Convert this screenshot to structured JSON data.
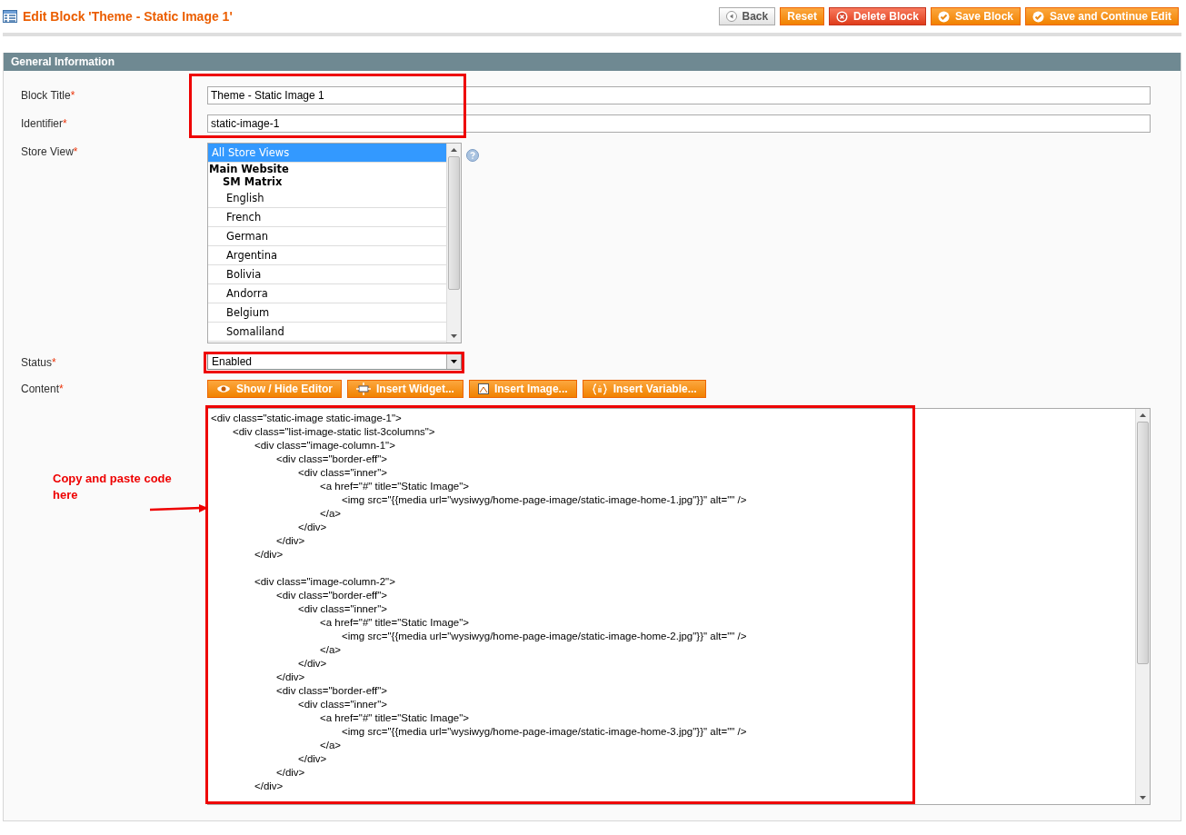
{
  "header": {
    "title": "Edit Block 'Theme - Static Image 1'",
    "buttons": [
      {
        "label": "Back",
        "kind": "back"
      },
      {
        "label": "Reset",
        "kind": "plain"
      },
      {
        "label": "Delete Block",
        "kind": "delete"
      },
      {
        "label": "Save Block",
        "kind": "save"
      },
      {
        "label": "Save and Continue Edit",
        "kind": "save"
      }
    ]
  },
  "section": {
    "title": "General Information"
  },
  "fields": {
    "block_title": {
      "label": "Block Title",
      "required": true,
      "value": "Theme - Static Image 1"
    },
    "identifier": {
      "label": "Identifier",
      "required": true,
      "value": "static-image-1"
    },
    "store_view": {
      "label": "Store View",
      "required": true,
      "options": [
        {
          "label": "All Store Views",
          "kind": "option",
          "selected": true
        },
        {
          "label": "Main Website",
          "kind": "group",
          "selected": false
        },
        {
          "label": "SM Matrix",
          "kind": "subgroup",
          "selected": false
        },
        {
          "label": "English",
          "kind": "option",
          "selected": false
        },
        {
          "label": "French",
          "kind": "option",
          "selected": false
        },
        {
          "label": "German",
          "kind": "option",
          "selected": false
        },
        {
          "label": "Argentina",
          "kind": "option",
          "selected": false
        },
        {
          "label": "Bolivia",
          "kind": "option",
          "selected": false
        },
        {
          "label": "Andorra",
          "kind": "option",
          "selected": false
        },
        {
          "label": "Belgium",
          "kind": "option",
          "selected": false
        },
        {
          "label": "Somaliland",
          "kind": "option",
          "selected": false
        }
      ]
    },
    "status": {
      "label": "Status",
      "required": true,
      "value": "Enabled"
    },
    "content": {
      "label": "Content",
      "required": true,
      "buttons": [
        {
          "label": "Show / Hide Editor",
          "kind": "eye"
        },
        {
          "label": "Insert Widget...",
          "kind": "widget"
        },
        {
          "label": "Insert Image...",
          "kind": "image"
        },
        {
          "label": "Insert Variable...",
          "kind": "variable"
        }
      ],
      "code_blocks": [
        {
          "lines": [
            "<div class=\"static-image static-image-1\">",
            "\t<div class=\"list-image-static list-3columns\">",
            "\t\t<div class=\"image-column-1\">",
            "\t\t\t<div class=\"border-eff\">",
            "\t\t\t\t<div class=\"inner\">",
            "\t\t\t\t\t<a href=\"#\" title=\"Static Image\">",
            "\t\t\t\t\t\t<img src=\"{{media url=\"wysiwyg/home-page-image/static-image-home-1.jpg\"}}\" alt=\"\" />",
            "\t\t\t\t\t</a>",
            "\t\t\t\t</div>",
            "\t\t\t</div>",
            "\t\t</div>"
          ]
        },
        {
          "lines": [
            "\t\t<div class=\"image-column-2\">",
            "\t\t\t<div class=\"border-eff\">",
            "\t\t\t\t<div class=\"inner\">",
            "\t\t\t\t\t<a href=\"#\" title=\"Static Image\">",
            "\t\t\t\t\t\t<img src=\"{{media url=\"wysiwyg/home-page-image/static-image-home-2.jpg\"}}\" alt=\"\" />",
            "\t\t\t\t\t</a>",
            "\t\t\t\t</div>",
            "\t\t\t</div>",
            "\t\t\t<div class=\"border-eff\">",
            "\t\t\t\t<div class=\"inner\">",
            "\t\t\t\t\t<a href=\"#\" title=\"Static Image\">",
            "\t\t\t\t\t\t<img src=\"{{media url=\"wysiwyg/home-page-image/static-image-home-3.jpg\"}}\" alt=\"\" />",
            "\t\t\t\t\t</a>",
            "\t\t\t\t</div>",
            "\t\t\t</div>",
            "\t\t</div>"
          ]
        }
      ]
    }
  },
  "required_marker": "*",
  "annotation": {
    "text": "Copy and paste code here"
  }
}
